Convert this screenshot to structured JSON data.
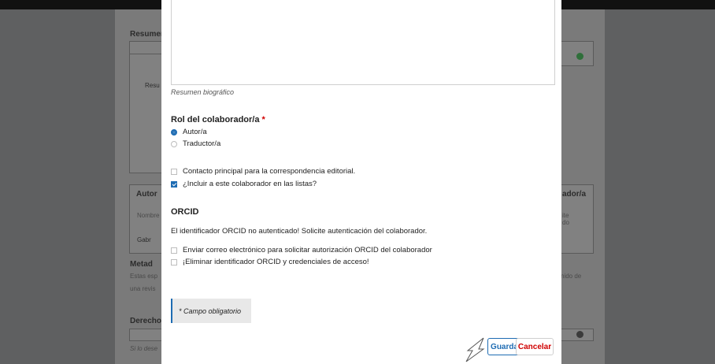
{
  "background": {
    "resumen_heading": "Resumen",
    "resumen_inner": "Resu",
    "autores_heading": "Autor",
    "nombre_col": "Nombre",
    "author_row": "Gabr",
    "right_button": "ador/a",
    "right_col_line1": "ite",
    "right_col_line2": "do",
    "metadata_heading": "Metad",
    "metadata_text_1": "Estas esp",
    "metadata_text_2": "una revis",
    "metadata_right": "nido de",
    "derechos_heading": "Derecho",
    "derechos_help": "Si lo dese"
  },
  "modal": {
    "bio_help": "Resumen biográfico",
    "role_label": "Rol del colaborador/a",
    "required_mark": "*",
    "roles": [
      {
        "label": "Autor/a",
        "selected": true
      },
      {
        "label": "Traductor/a",
        "selected": false
      }
    ],
    "options": [
      {
        "label": "Contacto principal para la correspondencia editorial.",
        "checked": false
      },
      {
        "label": "¿Incluir a este colaborador en las listas?",
        "checked": true
      }
    ],
    "orcid_heading": "ORCID",
    "orcid_message": "El identificador ORCID no autenticado! Solicite autenticación del colaborador.",
    "orcid_options": [
      {
        "label": "Enviar correo electrónico para solicitar autorización ORCID del colaborador",
        "checked": false
      },
      {
        "label": "¡Eliminar identificador ORCID y credenciales de acceso!",
        "checked": false
      }
    ],
    "required_note": "* Campo obligatorio",
    "save_label": "Guardar",
    "cancel_label": "Cancelar"
  },
  "colors": {
    "accent": "#1e6cb3",
    "danger": "#d00000",
    "overlay": "#5f6061"
  }
}
